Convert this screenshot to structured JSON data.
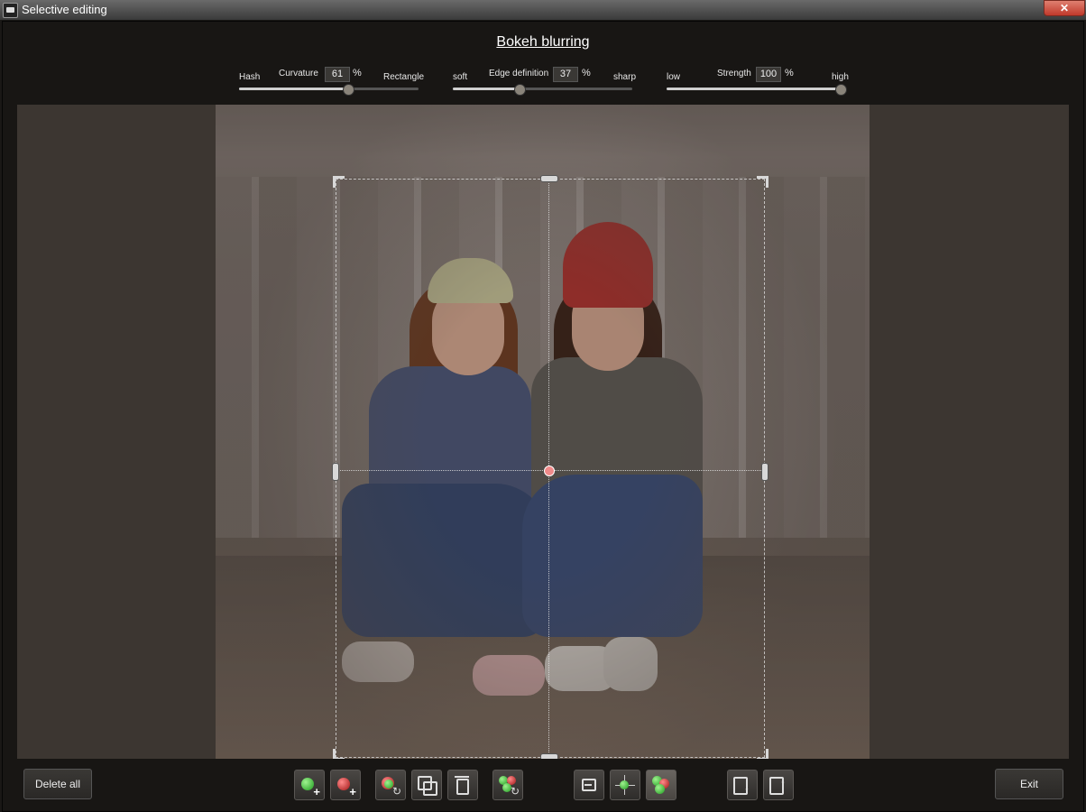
{
  "window": {
    "title": "Selective editing",
    "close_label": "✕"
  },
  "heading": "Bokeh blurring",
  "sliders": {
    "curvature": {
      "label": "Curvature",
      "value": "61",
      "percent": 61,
      "unit": "%",
      "left_end": "Hash",
      "right_end": "Rectangle"
    },
    "edge": {
      "label": "Edge definition",
      "value": "37",
      "percent": 37,
      "unit": "%",
      "left_end": "soft",
      "right_end": "sharp"
    },
    "strength": {
      "label": "Strength",
      "value": "100",
      "percent": 100,
      "unit": "%",
      "left_end": "low",
      "right_end": "high"
    }
  },
  "buttons": {
    "delete_all": "Delete all",
    "exit": "Exit"
  },
  "tools": [
    "add-green-point-icon",
    "add-red-point-icon",
    "swap-point-icon",
    "duplicate-icon",
    "delete-point-icon",
    "swap-all-points-icon",
    "minus-icon",
    "center-point-icon",
    "multi-point-icon",
    "export-mask-icon",
    "import-mask-icon"
  ],
  "colors": {
    "accent_green": "#1e9a1e",
    "accent_red": "#a01515",
    "center_point": "#f08a8a"
  }
}
